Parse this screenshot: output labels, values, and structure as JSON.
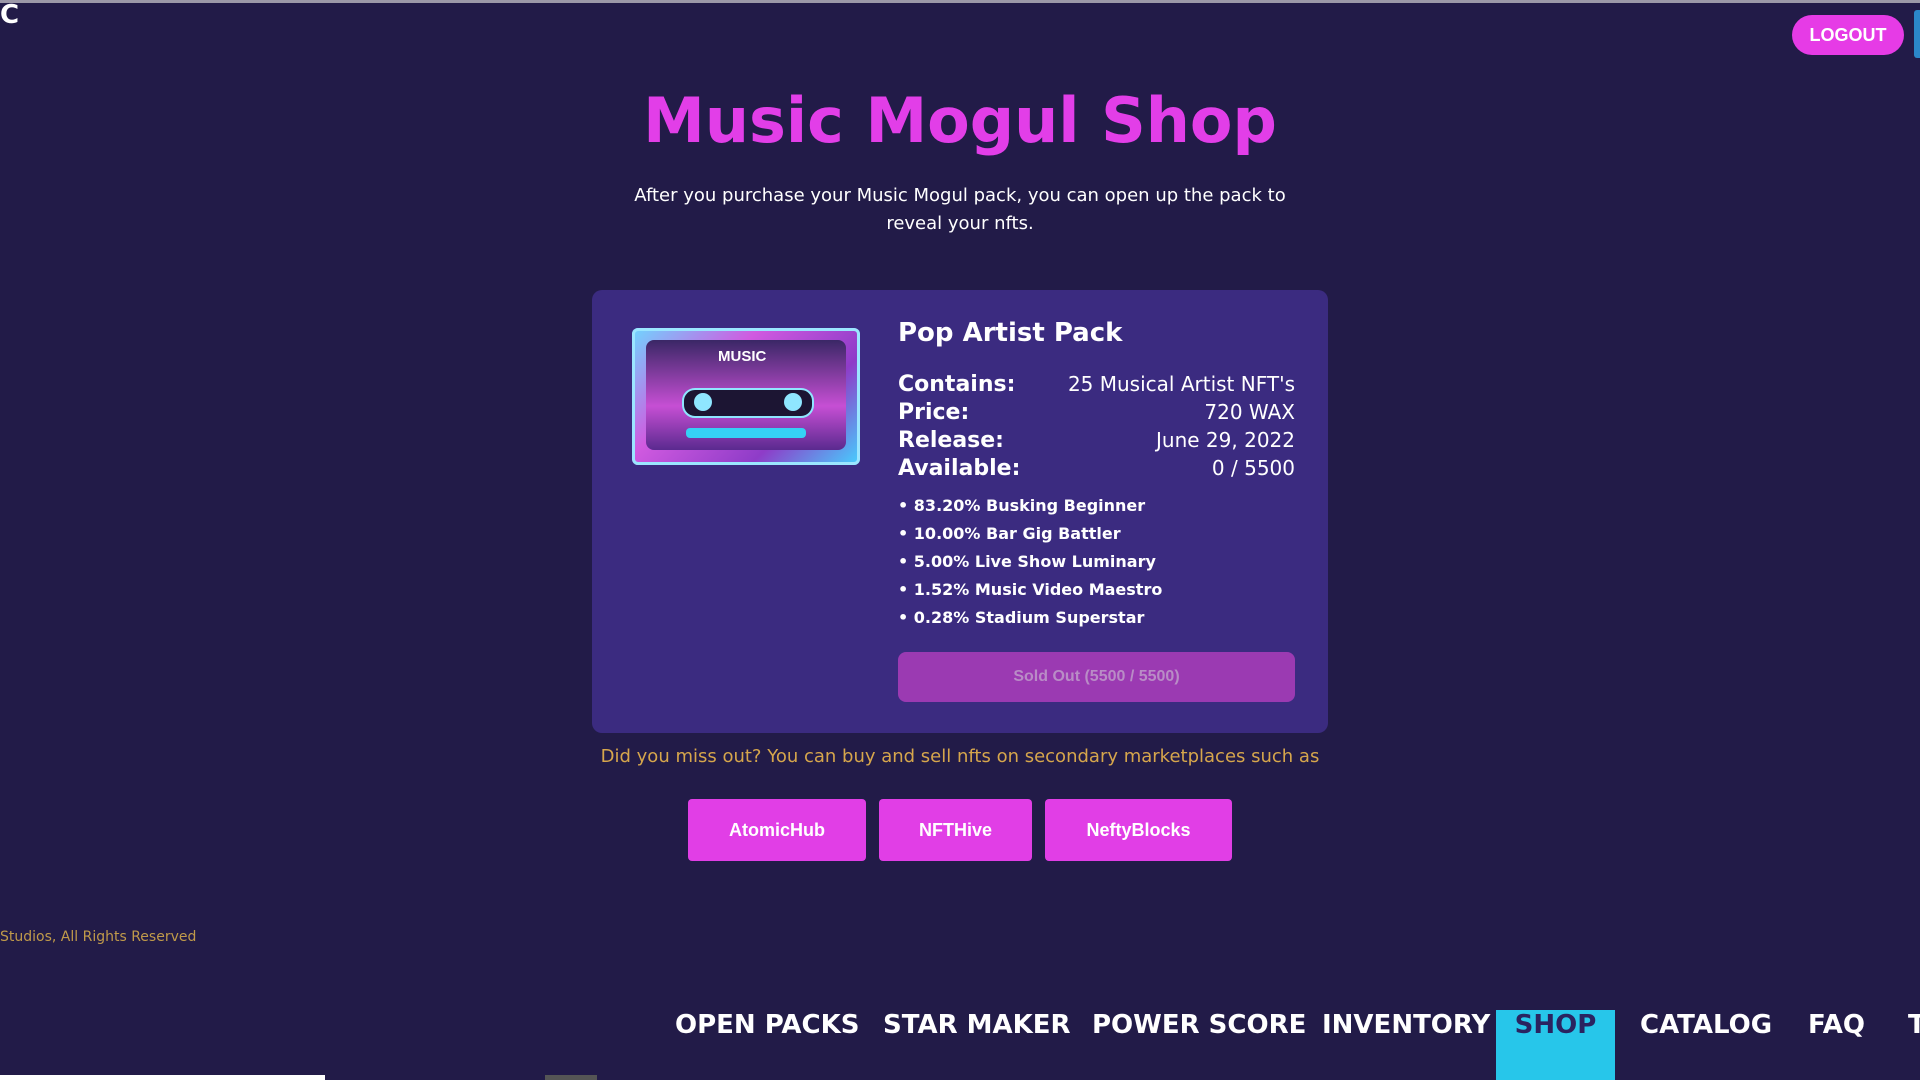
{
  "header": {
    "corner_text": "C",
    "logout_label": "LOGOUT"
  },
  "page": {
    "title": "Music Mogul Shop",
    "subtitle": "After you purchase your Music Mogul pack, you can open up the pack to reveal your nfts."
  },
  "pack": {
    "image_label": "MUSIC",
    "name": "Pop Artist Pack",
    "info": [
      {
        "key": "Contains:",
        "value": "25 Musical Artist NFT's"
      },
      {
        "key": "Price:",
        "value": "720 WAX"
      },
      {
        "key": "Release:",
        "value": "June 29, 2022"
      },
      {
        "key": "Available:",
        "value": "0 / 5500"
      }
    ],
    "odds": [
      "• 83.20% Busking Beginner",
      "• 10.00% Bar Gig Battler",
      "• 5.00% Live Show Luminary",
      "• 1.52% Music Video Maestro",
      "• 0.28% Stadium Superstar"
    ],
    "sold_out_label": "Sold Out (5500 / 5500)"
  },
  "secondary": {
    "text": "Did you miss out? You can buy and sell nfts on secondary marketplaces such as",
    "markets": [
      "AtomicHub",
      "NFTHive",
      "NeftyBlocks"
    ]
  },
  "footer": {
    "copyright": "Studios, All Rights Reserved"
  },
  "nav": {
    "items": [
      "OPEN PACKS",
      "STAR MAKER",
      "POWER SCORE",
      "INVENTORY",
      "SHOP",
      "CATALOG",
      "FAQ",
      "T"
    ],
    "active": "SHOP"
  },
  "colors": {
    "background": "#221b48",
    "accent": "#e23ee8",
    "card": "#3b2b80",
    "active_nav": "#27c6ea"
  }
}
